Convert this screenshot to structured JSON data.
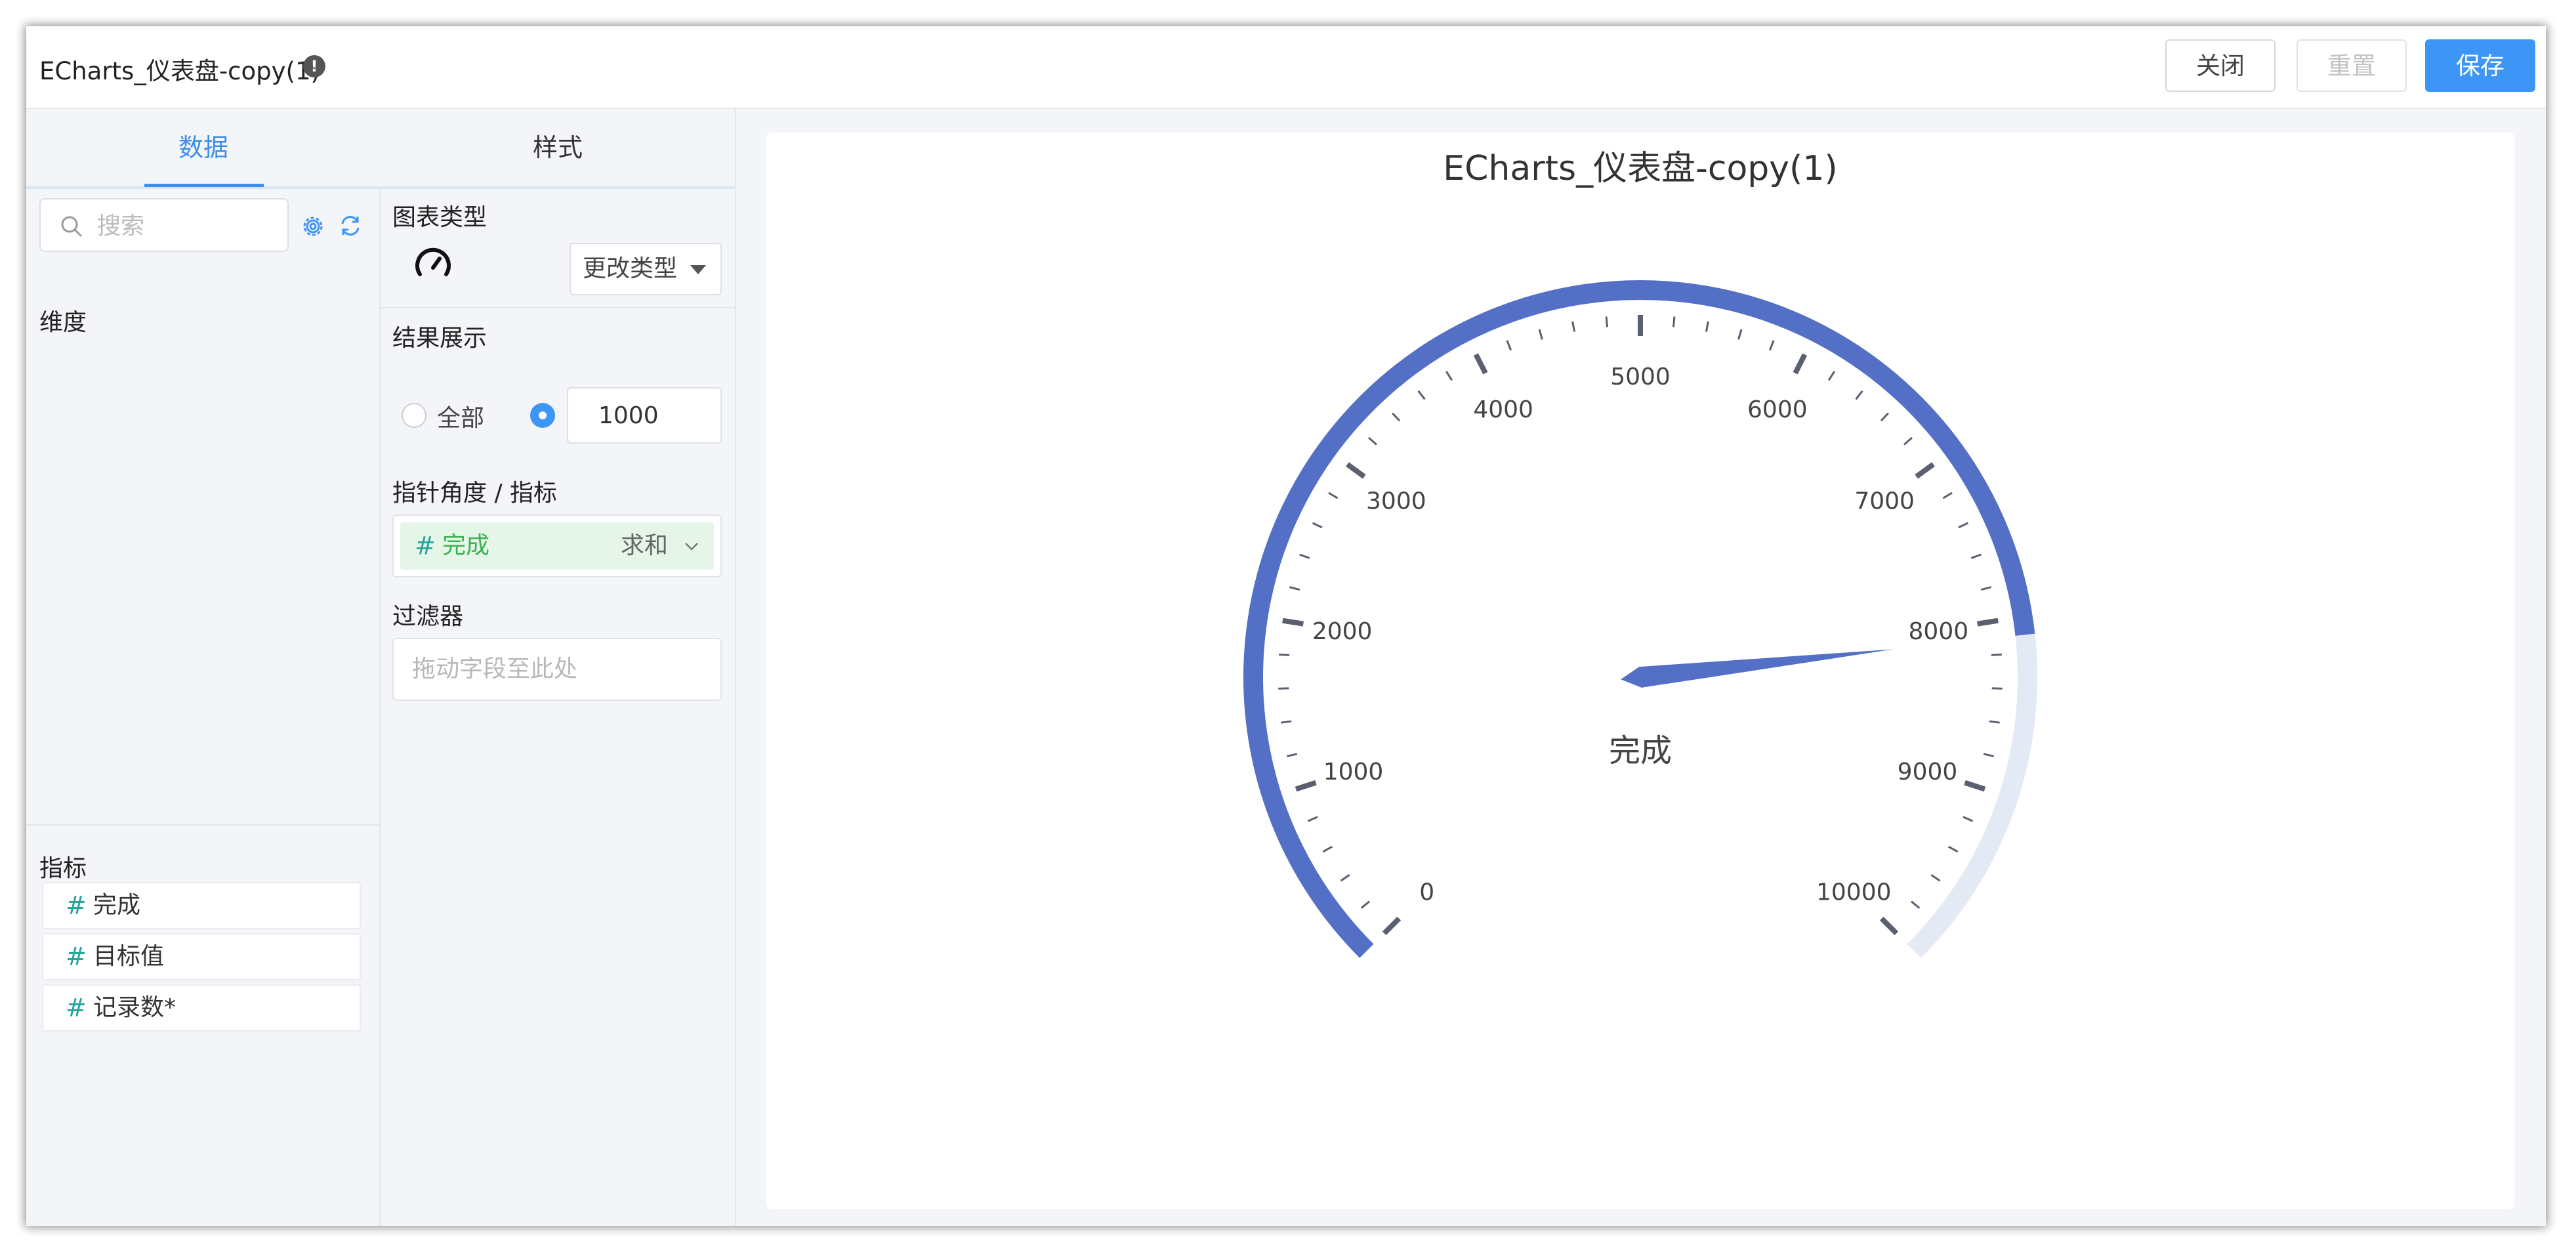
{
  "header": {
    "title": "ECharts_仪表盘-copy(1)",
    "info_icon": "!",
    "close_label": "关闭",
    "reset_label": "重置",
    "save_label": "保存"
  },
  "tabs": {
    "data_label": "数据",
    "style_label": "样式"
  },
  "fields_panel": {
    "search_placeholder": "搜索",
    "dimension_title": "维度",
    "metric_title": "指标",
    "metrics": [
      {
        "label": "完成"
      },
      {
        "label": "目标值"
      },
      {
        "label": "记录数*"
      }
    ]
  },
  "config_panel": {
    "chart_type_label": "图表类型",
    "chart_type_icon": "gauge-icon",
    "change_type_label": "更改类型",
    "result_label": "结果展示",
    "all_label": "全部",
    "limit_value": "1000",
    "pointer_label": "指针角度 / 指标",
    "field_name": "完成",
    "field_agg": "求和",
    "filter_label": "过滤器",
    "filter_placeholder": "拖动字段至此处"
  },
  "colors": {
    "accent": "#3d95f5",
    "gauge_progress": "#5470c6",
    "gauge_track": "#e3e9f5",
    "tick": "#5a6070"
  },
  "chart_data": {
    "type": "gauge",
    "title": "ECharts_仪表盘-copy(1)",
    "min": 0,
    "max": 10000,
    "tick_labels": [
      "0",
      "1000",
      "2000",
      "3000",
      "4000",
      "5000",
      "6000",
      "7000",
      "8000",
      "9000",
      "10000"
    ],
    "series": [
      {
        "name": "完成",
        "value": 8100
      }
    ],
    "detail_label": "完成"
  }
}
